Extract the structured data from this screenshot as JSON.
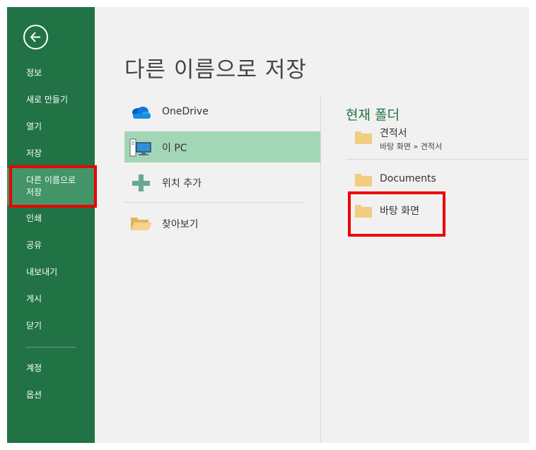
{
  "window": {
    "title": "다른 이름으로 저장"
  },
  "sidebar": {
    "items": [
      {
        "label": "정보"
      },
      {
        "label": "새로 만들기"
      },
      {
        "label": "열기"
      },
      {
        "label": "저장"
      },
      {
        "label": "다른 이름으로\n저장",
        "selected": true
      },
      {
        "label": "인쇄"
      },
      {
        "label": "공유"
      },
      {
        "label": "내보내기"
      },
      {
        "label": "게시"
      },
      {
        "label": "닫기"
      },
      {
        "label": "계정"
      },
      {
        "label": "옵션"
      }
    ]
  },
  "locations": [
    {
      "label": "OneDrive",
      "icon": "onedrive-cloud-icon"
    },
    {
      "label": "이 PC",
      "icon": "this-pc-icon",
      "selected": true
    },
    {
      "label": "위치 추가",
      "icon": "plus-icon"
    },
    {
      "label": "찾아보기",
      "icon": "open-folder-icon"
    }
  ],
  "current_folder": {
    "title": "현재 폴더",
    "folders": [
      {
        "name": "견적서",
        "path": "바탕 화면 » 견적서"
      },
      {
        "name": "Documents"
      },
      {
        "name": "바탕 화면"
      }
    ]
  },
  "colors": {
    "sidebar": "#217346",
    "sidebar_selected": "#439467",
    "location_selected": "#a3d6b7",
    "accent_text": "#217346",
    "highlight_box": "#ee0000",
    "folder": "#f2cc7f"
  }
}
